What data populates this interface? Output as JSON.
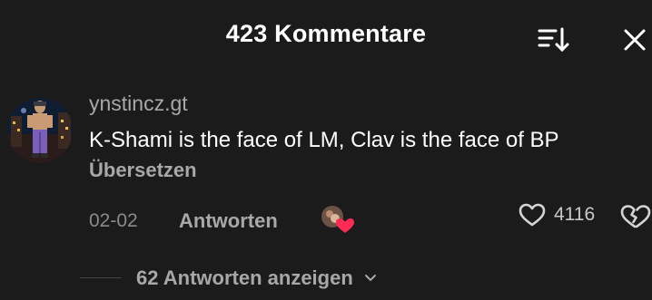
{
  "header": {
    "title": "423 Kommentare",
    "sort_icon": "sort-down-icon",
    "close_icon": "close-icon"
  },
  "comment": {
    "username": "ynstincz.gt",
    "text": "K-Shami is the face of LM, Clav is the face of BP",
    "translate_label": "Übersetzen",
    "date": "02-02",
    "reply_label": "Antworten",
    "like_count": "4116",
    "liked_by_creator_icon": "creator-heart-badge-icon",
    "like_icon": "heart-outline-icon",
    "dislike_icon": "broken-heart-icon"
  },
  "replies": {
    "toggle_label": "62 Antworten anzeigen",
    "toggle_icon": "chevron-down-icon"
  },
  "colors": {
    "background": "#1b1b1b",
    "primary_text": "#ffffff",
    "secondary_text": "#a8a8a8",
    "creator_heart": "#fe2c55"
  }
}
